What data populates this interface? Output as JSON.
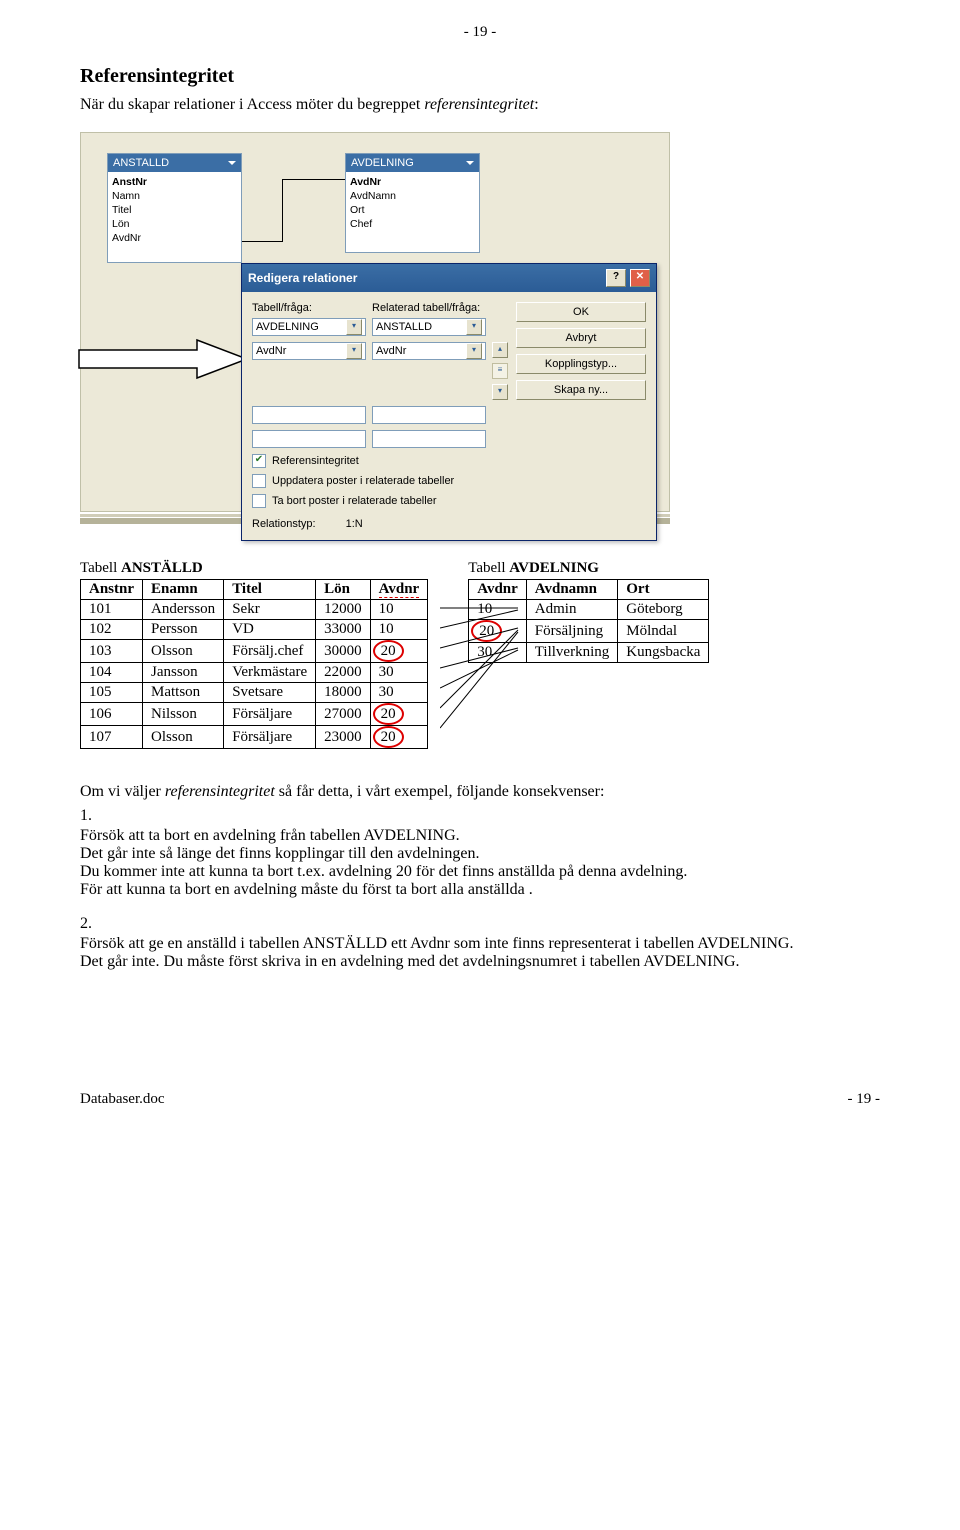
{
  "page_top": "- 19 -",
  "heading": "Referensintegritet",
  "intro_prefix": "När du skapar relationer i Access möter du begreppet ",
  "intro_term": "referensintegritet",
  "intro_suffix": ":",
  "access": {
    "table1": {
      "title": "ANSTALLD",
      "fields": [
        "AnstNr",
        "Namn",
        "Titel",
        "Lön",
        "AvdNr"
      ]
    },
    "table2": {
      "title": "AVDELNING",
      "fields": [
        "AvdNr",
        "AvdNamn",
        "Ort",
        "Chef"
      ]
    },
    "dialog": {
      "title": "Redigera relationer",
      "label_left": "Tabell/fråga:",
      "label_right": "Relaterad tabell/fråga:",
      "sel_left": "AVDELNING",
      "sel_right": "ANSTALLD",
      "fld_left": "AvdNr",
      "fld_right": "AvdNr",
      "chk1": "Referensintegritet",
      "chk2": "Uppdatera poster i relaterade tabeller",
      "chk3": "Ta bort poster i relaterade tabeller",
      "rel_label": "Relationstyp:",
      "rel_value": "1:N",
      "btn_ok": "OK",
      "btn_cancel": "Avbryt",
      "btn_join": "Kopplingstyp...",
      "btn_new": "Skapa ny..."
    }
  },
  "anst": {
    "label_prefix": "Tabell ",
    "label_bold": "ANSTÄLLD",
    "headers": [
      "Anstnr",
      "Enamn",
      "Titel",
      "Lön",
      "Avdnr"
    ],
    "rows": [
      [
        "101",
        "Andersson",
        "Sekr",
        "12000",
        "10"
      ],
      [
        "102",
        "Persson",
        "VD",
        "33000",
        "10"
      ],
      [
        "103",
        "Olsson",
        "Försälj.chef",
        "30000",
        "20"
      ],
      [
        "104",
        "Jansson",
        "Verkmästare",
        "22000",
        "30"
      ],
      [
        "105",
        "Mattson",
        "Svetsare",
        "18000",
        "30"
      ],
      [
        "106",
        "Nilsson",
        "Försäljare",
        "27000",
        "20"
      ],
      [
        "107",
        "Olsson",
        "Försäljare",
        "23000",
        "20"
      ]
    ]
  },
  "avd": {
    "label_prefix": "Tabell ",
    "label_bold": "AVDELNING",
    "headers": [
      "Avdnr",
      "Avdnamn",
      "Ort"
    ],
    "rows": [
      [
        "10",
        "Admin",
        "Göteborg"
      ],
      [
        "20",
        "Försäljning",
        "Mölndal"
      ],
      [
        "30",
        "Tillverkning",
        "Kungsbacka"
      ]
    ]
  },
  "body1_intro_a": "Om vi väljer ",
  "body1_intro_term": "referensintegritet",
  "body1_intro_b": " så får detta, i vårt exempel, följande konsekvenser:",
  "b1_num": "1.",
  "b1_l1": "Försök att ta bort en avdelning från tabellen AVDELNING.",
  "b1_l2": "Det går inte så länge det finns kopplingar till den avdelningen.",
  "b1_l3": "Du kommer inte att kunna ta bort t.ex. avdelning 20 för det finns anställda på denna avdelning.",
  "b1_l4": "För att kunna ta bort en avdelning måste du först ta bort alla anställda .",
  "b2_num": "2.",
  "b2_l1": "Försök att ge en anställd i tabellen ANSTÄLLD ett Avdnr som inte finns representerat i tabellen AVDELNING.",
  "b2_l2": "Det går inte. Du måste först skriva in en avdelning med det avdelningsnumret i tabellen AVDELNING.",
  "footer_left": "Databaser.doc",
  "footer_right": "- 19 -"
}
